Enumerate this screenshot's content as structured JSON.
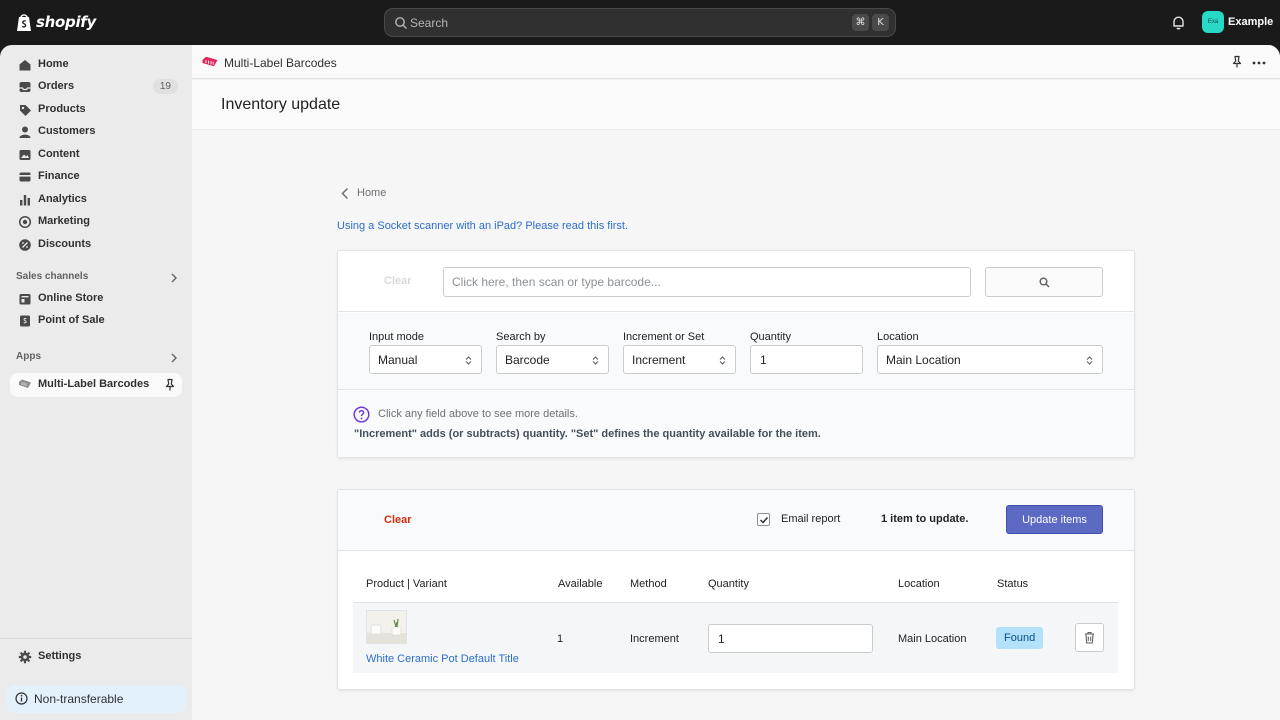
{
  "topbar": {
    "brand": "shopify",
    "search_placeholder": "Search",
    "shortcut_keys": [
      "⌘",
      "K"
    ],
    "avatar_initials": "Exa",
    "store_name": "Example"
  },
  "sidebar": {
    "items": [
      {
        "label": "Home",
        "icon": "home-icon"
      },
      {
        "label": "Orders",
        "icon": "inbox-icon",
        "badge": "19"
      },
      {
        "label": "Products",
        "icon": "tag-icon"
      },
      {
        "label": "Customers",
        "icon": "person-icon"
      },
      {
        "label": "Content",
        "icon": "image-icon"
      },
      {
        "label": "Finance",
        "icon": "bank-icon"
      },
      {
        "label": "Analytics",
        "icon": "bar-chart-icon"
      },
      {
        "label": "Marketing",
        "icon": "target-icon"
      },
      {
        "label": "Discounts",
        "icon": "discount-icon"
      }
    ],
    "sales_channels_heading": "Sales channels",
    "sales_channels": [
      {
        "label": "Online Store",
        "icon": "store-icon"
      },
      {
        "label": "Point of Sale",
        "icon": "pos-icon"
      }
    ],
    "apps_heading": "Apps",
    "apps": [
      {
        "label": "Multi-Label Barcodes",
        "icon": "barcode-app-icon"
      }
    ],
    "settings_label": "Settings",
    "plan_notice": "Non-transferable"
  },
  "app": {
    "name": "Multi-Label Barcodes",
    "page_title": "Inventory update",
    "back_label": "Home",
    "info_link": "Using a Socket scanner with an iPad? Please read this first."
  },
  "scan": {
    "clear_label": "Clear",
    "placeholder": "Click here, then scan or type barcode..."
  },
  "options": {
    "input_mode": {
      "label": "Input mode",
      "value": "Manual"
    },
    "search_by": {
      "label": "Search by",
      "value": "Barcode"
    },
    "increment_or_set": {
      "label": "Increment or Set",
      "value": "Increment"
    },
    "quantity": {
      "label": "Quantity",
      "value": "1"
    },
    "location": {
      "label": "Location",
      "value": "Main Location"
    }
  },
  "help": {
    "hint": "Click any field above to see more details.",
    "note": "\"Increment\" adds (or subtracts) quantity. \"Set\" defines the quantity available for the item."
  },
  "summary": {
    "clear_label": "Clear",
    "email_report_label": "Email report",
    "email_report_checked": true,
    "count_text": "1 item to update.",
    "update_button": "Update items"
  },
  "table": {
    "columns": [
      "Product | Variant",
      "Available",
      "Method",
      "Quantity",
      "Location",
      "Status"
    ],
    "rows": [
      {
        "product": "White Ceramic Pot Default Title",
        "available": "1",
        "method": "Increment",
        "quantity": "1",
        "location": "Main Location",
        "status": "Found"
      }
    ]
  },
  "colors": {
    "accent": "#5c6ac4",
    "link": "#2c6ecb",
    "danger": "#d82c0d",
    "status_found": "#b4e1fa",
    "avatar": "#28d9c5"
  }
}
